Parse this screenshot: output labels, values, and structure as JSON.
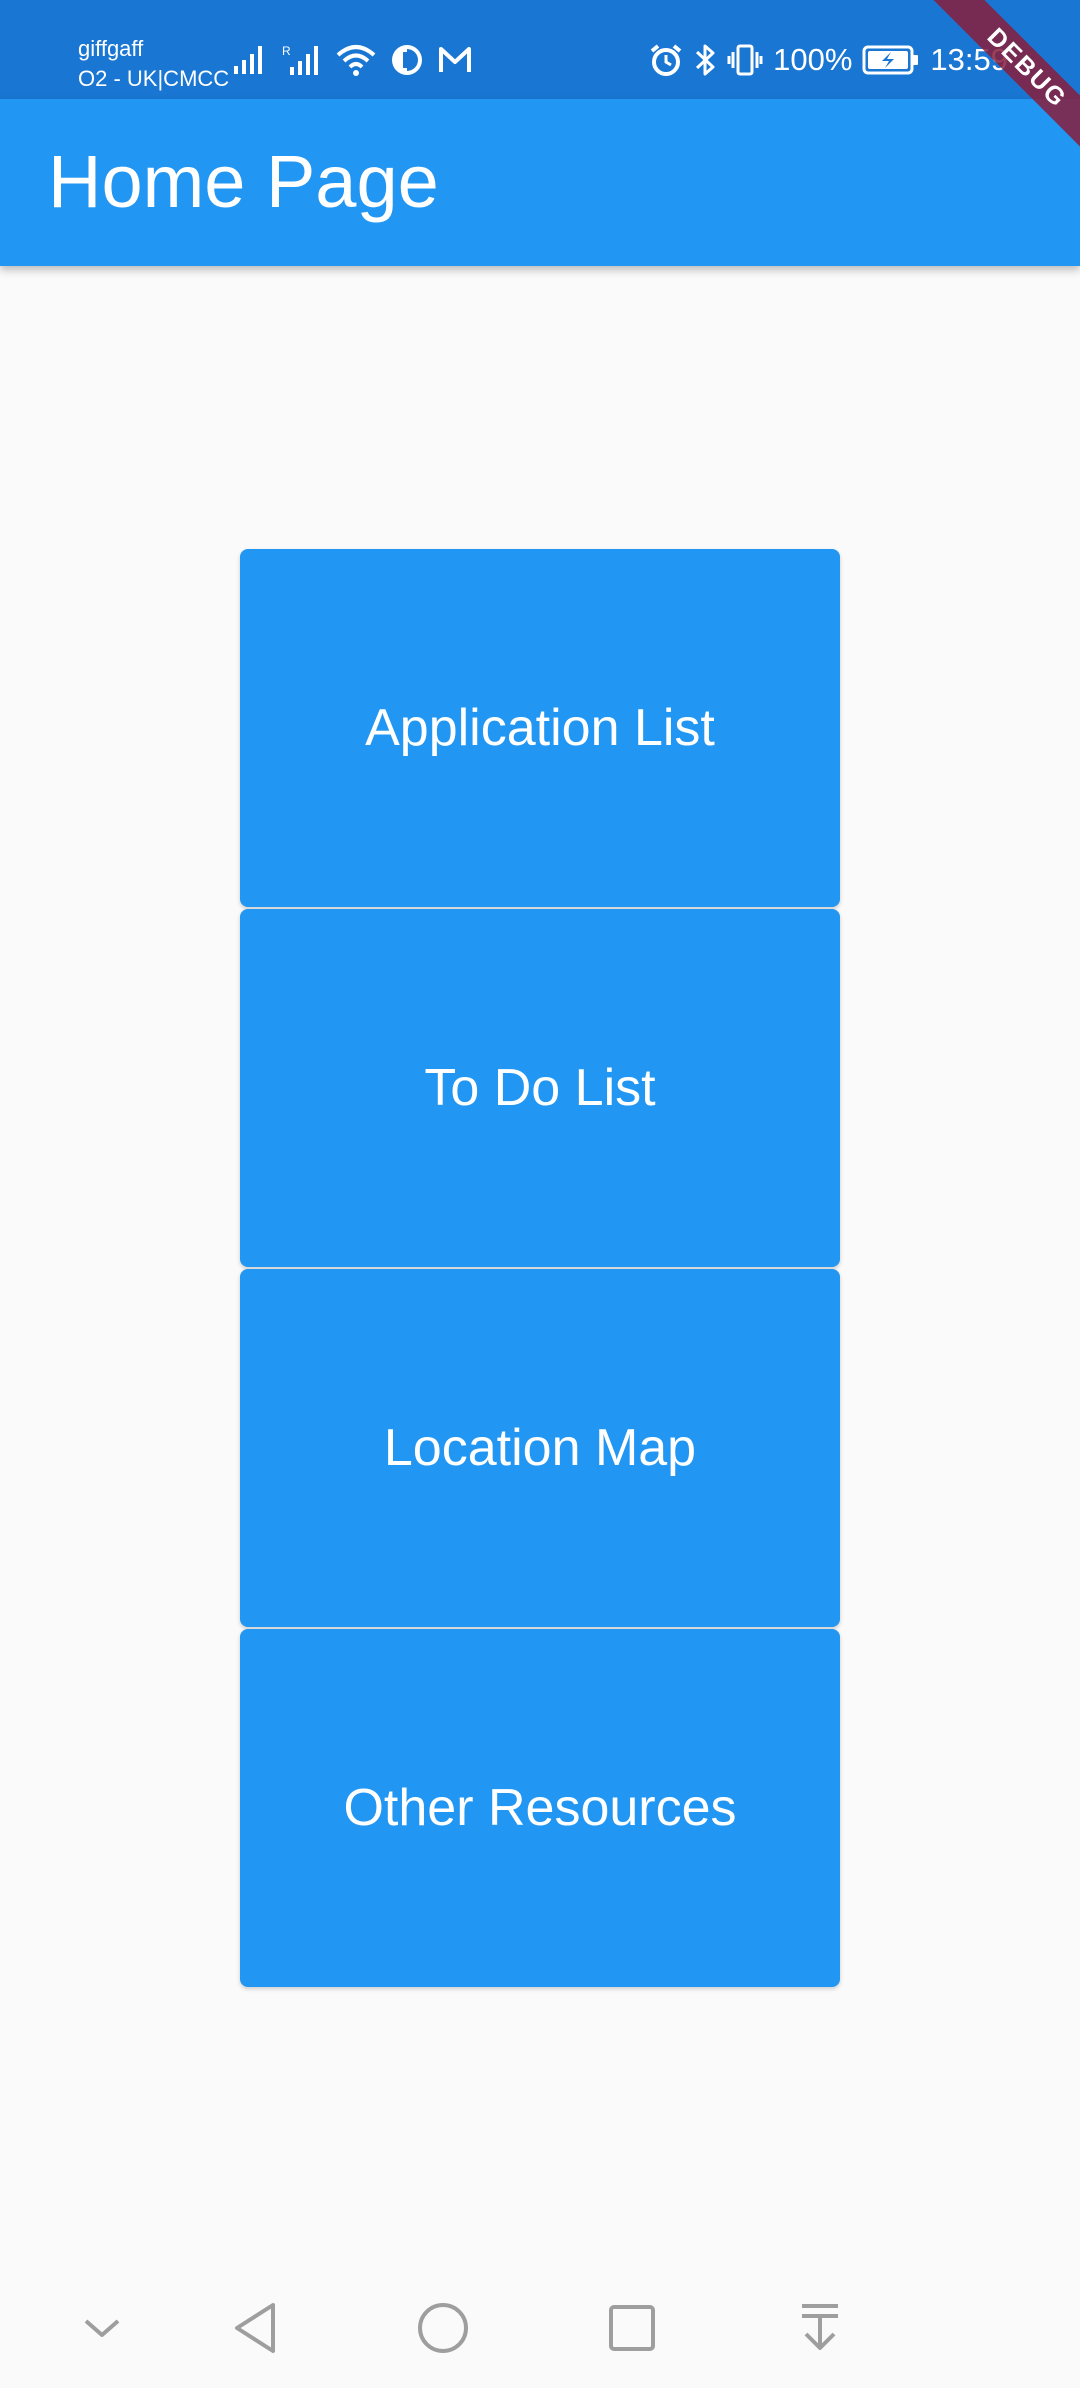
{
  "status_bar": {
    "carrier_name": "giffgaff",
    "carrier_network": "O2 - UK|CMCC",
    "battery": "100%",
    "time": "13:59",
    "icons": [
      "signal-icon",
      "roaming-signal-icon",
      "wifi-icon",
      "data-saver-icon",
      "gmail-icon",
      "alarm-icon",
      "bluetooth-icon",
      "vibrate-icon",
      "battery-charging-icon"
    ]
  },
  "debug_banner": "DEBUG",
  "app_bar": {
    "title": "Home Page"
  },
  "menu": {
    "buttons": [
      {
        "label": "Application List"
      },
      {
        "label": "To Do List"
      },
      {
        "label": "Location Map"
      },
      {
        "label": "Other Resources"
      }
    ]
  },
  "nav_bar": {
    "icons": [
      "chevron-down-icon",
      "back-icon",
      "home-icon",
      "recents-icon",
      "notification-pull-down-icon"
    ]
  },
  "colors": {
    "status_bar": "#1976d2",
    "app_bar": "#2196f3",
    "button": "#2196f3",
    "background": "#fafafa",
    "debug_ribbon": "#881e3c"
  }
}
